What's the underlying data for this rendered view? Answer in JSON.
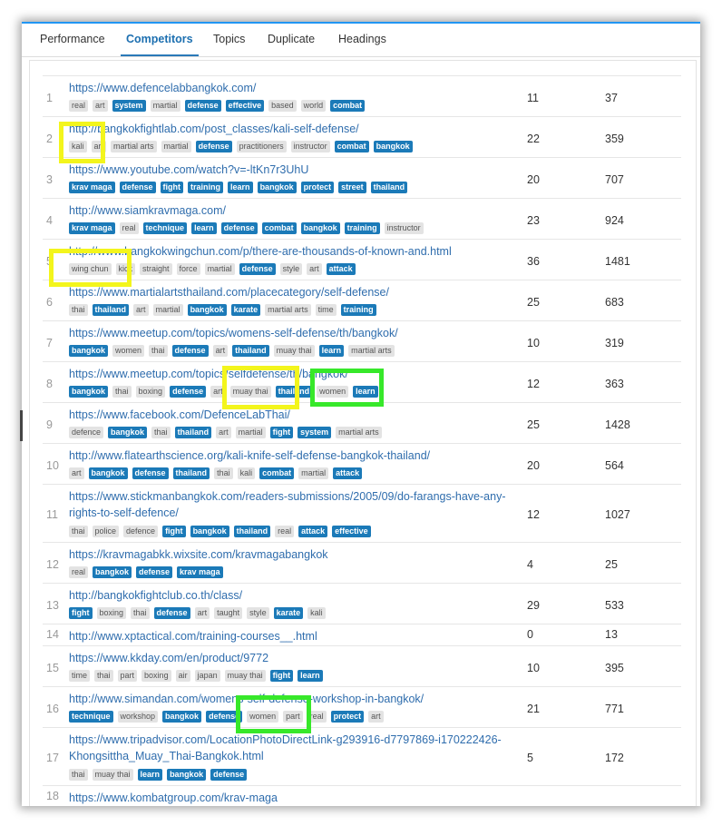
{
  "tabs": [
    {
      "label": "Performance",
      "active": false
    },
    {
      "label": "Competitors",
      "active": true
    },
    {
      "label": "Topics",
      "active": false
    },
    {
      "label": "Duplicate",
      "active": false
    },
    {
      "label": "Headings",
      "active": false
    }
  ],
  "colors": {
    "accent": "#1b7ab8",
    "link": "#2f6dad",
    "highlight_yellow": "#f3f51c",
    "highlight_green": "#37e82a"
  },
  "rows": [
    {
      "num": "1",
      "url": [
        "https://www.defencelabbangkok.com/"
      ],
      "tags": [
        [
          "real",
          0
        ],
        [
          "art",
          0
        ],
        [
          "system",
          1
        ],
        [
          "martial",
          0
        ],
        [
          "defense",
          1
        ],
        [
          "effective",
          1
        ],
        [
          "based",
          0
        ],
        [
          "world",
          0
        ],
        [
          "combat",
          1
        ]
      ],
      "v1": "11",
      "v2": "37"
    },
    {
      "num": "2",
      "url": [
        "http://bangkokfightlab.com/post_classes/kali-self-defense/"
      ],
      "tags": [
        [
          "kali",
          0
        ],
        [
          "art",
          0
        ],
        [
          "martial arts",
          0
        ],
        [
          "martial",
          0
        ],
        [
          "defense",
          1
        ],
        [
          "practitioners",
          0
        ],
        [
          "instructor",
          0
        ],
        [
          "combat",
          1
        ],
        [
          "bangkok",
          1
        ]
      ],
      "v1": "22",
      "v2": "359"
    },
    {
      "num": "3",
      "url": [
        "https://www.youtube.com/watch?v=-ltKn7r3UhU"
      ],
      "tags": [
        [
          "krav maga",
          1
        ],
        [
          "defense",
          1
        ],
        [
          "fight",
          1
        ],
        [
          "training",
          1
        ],
        [
          "learn",
          1
        ],
        [
          "bangkok",
          1
        ],
        [
          "protect",
          1
        ],
        [
          "street",
          1
        ],
        [
          "thailand",
          1
        ]
      ],
      "v1": "20",
      "v2": "707"
    },
    {
      "num": "4",
      "url": [
        "http://www.siamkravmaga.com/"
      ],
      "tags": [
        [
          "krav maga",
          1
        ],
        [
          "real",
          0
        ],
        [
          "technique",
          1
        ],
        [
          "learn",
          1
        ],
        [
          "defense",
          1
        ],
        [
          "combat",
          1
        ],
        [
          "bangkok",
          1
        ],
        [
          "training",
          1
        ],
        [
          "instructor",
          0
        ]
      ],
      "v1": "23",
      "v2": "924"
    },
    {
      "num": "5",
      "url": [
        "http://www.bangkokwingchun.com/p/there-are-thousands-of-known-and.html"
      ],
      "tags": [
        [
          "wing chun",
          0
        ],
        [
          "kick",
          0
        ],
        [
          "straight",
          0
        ],
        [
          "force",
          0
        ],
        [
          "martial",
          0
        ],
        [
          "defense",
          1
        ],
        [
          "style",
          0
        ],
        [
          "art",
          0
        ],
        [
          "attack",
          1
        ]
      ],
      "v1": "36",
      "v2": "1481"
    },
    {
      "num": "6",
      "url": [
        "https://www.martialartsthailand.com/placecategory/self-defense/"
      ],
      "tags": [
        [
          "thai",
          0
        ],
        [
          "thailand",
          1
        ],
        [
          "art",
          0
        ],
        [
          "martial",
          0
        ],
        [
          "bangkok",
          1
        ],
        [
          "karate",
          1
        ],
        [
          "martial arts",
          0
        ],
        [
          "time",
          0
        ],
        [
          "training",
          1
        ]
      ],
      "v1": "25",
      "v2": "683"
    },
    {
      "num": "7",
      "url": [
        "https://www.meetup.com/topics/womens-self-defense/th/bangkok/"
      ],
      "tags": [
        [
          "bangkok",
          1
        ],
        [
          "women",
          0
        ],
        [
          "thai",
          0
        ],
        [
          "defense",
          1
        ],
        [
          "art",
          0
        ],
        [
          "thailand",
          1
        ],
        [
          "muay thai",
          0
        ],
        [
          "learn",
          1
        ],
        [
          "martial arts",
          0
        ]
      ],
      "v1": "10",
      "v2": "319"
    },
    {
      "num": "8",
      "url": [
        "https://www.meetup.com/topics/selfdefense/th/bangkok/"
      ],
      "tags": [
        [
          "bangkok",
          1
        ],
        [
          "thai",
          0
        ],
        [
          "boxing",
          0
        ],
        [
          "defense",
          1
        ],
        [
          "art",
          0
        ],
        [
          "muay thai",
          0
        ],
        [
          "thailand",
          1
        ],
        [
          "women",
          0
        ],
        [
          "learn",
          1
        ]
      ],
      "v1": "12",
      "v2": "363"
    },
    {
      "num": "9",
      "url": [
        "https://www.facebook.com/DefenceLabThai/"
      ],
      "tags": [
        [
          "defence",
          0
        ],
        [
          "bangkok",
          1
        ],
        [
          "thai",
          0
        ],
        [
          "thailand",
          1
        ],
        [
          "art",
          0
        ],
        [
          "martial",
          0
        ],
        [
          "fight",
          1
        ],
        [
          "system",
          1
        ],
        [
          "martial arts",
          0
        ]
      ],
      "v1": "25",
      "v2": "1428"
    },
    {
      "num": "10",
      "url": [
        "http://www.flatearthscience.org/kali-knife-self-defense-bangkok-thailand/"
      ],
      "tags": [
        [
          "art",
          0
        ],
        [
          "bangkok",
          1
        ],
        [
          "defense",
          1
        ],
        [
          "thailand",
          1
        ],
        [
          "thai",
          0
        ],
        [
          "kali",
          0
        ],
        [
          "combat",
          1
        ],
        [
          "martial",
          0
        ],
        [
          "attack",
          1
        ]
      ],
      "v1": "20",
      "v2": "564"
    },
    {
      "num": "11",
      "url": [
        "https://www.stickmanbangkok.com/readers-submissions/2005/09/do-farangs-have-any-",
        "rights-to-self-defence/"
      ],
      "tags": [
        [
          "thai",
          0
        ],
        [
          "police",
          0
        ],
        [
          "defence",
          0
        ],
        [
          "fight",
          1
        ],
        [
          "bangkok",
          1
        ],
        [
          "thailand",
          1
        ],
        [
          "real",
          0
        ],
        [
          "attack",
          1
        ],
        [
          "effective",
          1
        ]
      ],
      "v1": "12",
      "v2": "1027"
    },
    {
      "num": "12",
      "url": [
        "https://kravmagabkk.wixsite.com/kravmagabangkok"
      ],
      "tags": [
        [
          "real",
          0
        ],
        [
          "bangkok",
          1
        ],
        [
          "defense",
          1
        ],
        [
          "krav maga",
          1
        ]
      ],
      "v1": "4",
      "v2": "25"
    },
    {
      "num": "13",
      "url": [
        "http://bangkokfightclub.co.th/class/"
      ],
      "tags": [
        [
          "fight",
          1
        ],
        [
          "boxing",
          0
        ],
        [
          "thai",
          0
        ],
        [
          "defense",
          1
        ],
        [
          "art",
          0
        ],
        [
          "taught",
          0
        ],
        [
          "style",
          0
        ],
        [
          "karate",
          1
        ],
        [
          "kali",
          0
        ]
      ],
      "v1": "29",
      "v2": "533"
    },
    {
      "num": "14",
      "url": [
        "http://www.xptactical.com/training-courses__.html"
      ],
      "tags": [],
      "v1": "0",
      "v2": "13"
    },
    {
      "num": "15",
      "url": [
        "https://www.kkday.com/en/product/9772"
      ],
      "tags": [
        [
          "time",
          0
        ],
        [
          "thai",
          0
        ],
        [
          "part",
          0
        ],
        [
          "boxing",
          0
        ],
        [
          "air",
          0
        ],
        [
          "japan",
          0
        ],
        [
          "muay thai",
          0
        ],
        [
          "fight",
          1
        ],
        [
          "learn",
          1
        ]
      ],
      "v1": "10",
      "v2": "395"
    },
    {
      "num": "16",
      "url": [
        "http://www.simandan.com/womens-self-defense-workshop-in-bangkok/"
      ],
      "tags": [
        [
          "technique",
          1
        ],
        [
          "workshop",
          0
        ],
        [
          "bangkok",
          1
        ],
        [
          "defense",
          1
        ],
        [
          "women",
          0
        ],
        [
          "part",
          0
        ],
        [
          "real",
          0
        ],
        [
          "protect",
          1
        ],
        [
          "art",
          0
        ]
      ],
      "v1": "21",
      "v2": "771"
    },
    {
      "num": "17",
      "url": [
        "https://www.tripadvisor.com/LocationPhotoDirectLink-g293916-d7797869-i170222426-",
        "Khongsittha_Muay_Thai-Bangkok.html"
      ],
      "tags": [
        [
          "thai",
          0
        ],
        [
          "muay thai",
          0
        ],
        [
          "learn",
          1
        ],
        [
          "bangkok",
          1
        ],
        [
          "defense",
          1
        ]
      ],
      "v1": "5",
      "v2": "172"
    },
    {
      "num": "18",
      "url": [
        "https://www.kombatgroup.com/krav-maga"
      ],
      "tags": [],
      "v1": "",
      "v2": ""
    }
  ]
}
